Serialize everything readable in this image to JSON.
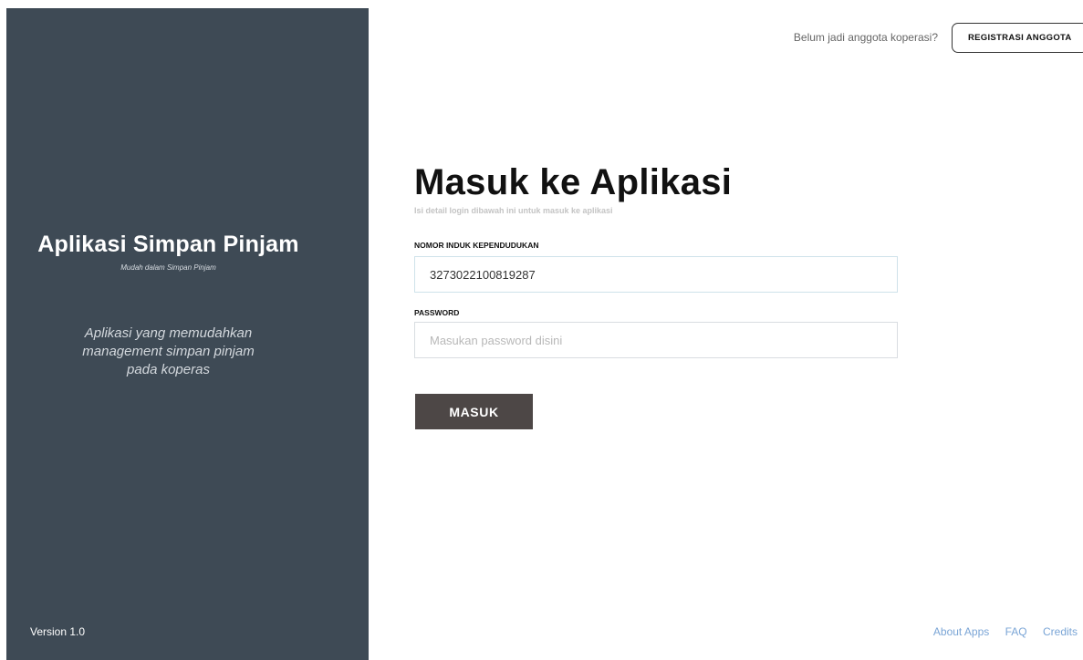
{
  "sidebar": {
    "app_title": "Aplikasi Simpan Pinjam",
    "tagline": "Mudah dalam Simpan Pinjam",
    "description_lines": [
      "Aplikasi yang memudahkan",
      "management simpan pinjam",
      "pada koperas"
    ],
    "version": "Version 1.0"
  },
  "header": {
    "prompt": "Belum jadi anggota koperasi?",
    "register_label": "REGISTRASI ANGGOTA"
  },
  "login": {
    "title": "Masuk ke Aplikasi",
    "subtitle": "Isi detail login dibawah ini untuk masuk ke aplikasi",
    "nik_label": "NOMOR INDUK KEPENDUDUKAN",
    "nik_value": "3273022100819287",
    "password_label": "PASSWORD",
    "password_placeholder": "Masukan password disini",
    "submit_label": "MASUK"
  },
  "footer": {
    "links": [
      "About Apps",
      "FAQ",
      "Credits"
    ]
  },
  "colors": {
    "sidebar_bg": "#3e4a55",
    "submit_bg": "#4d4746",
    "link": "#7aa5d6"
  }
}
